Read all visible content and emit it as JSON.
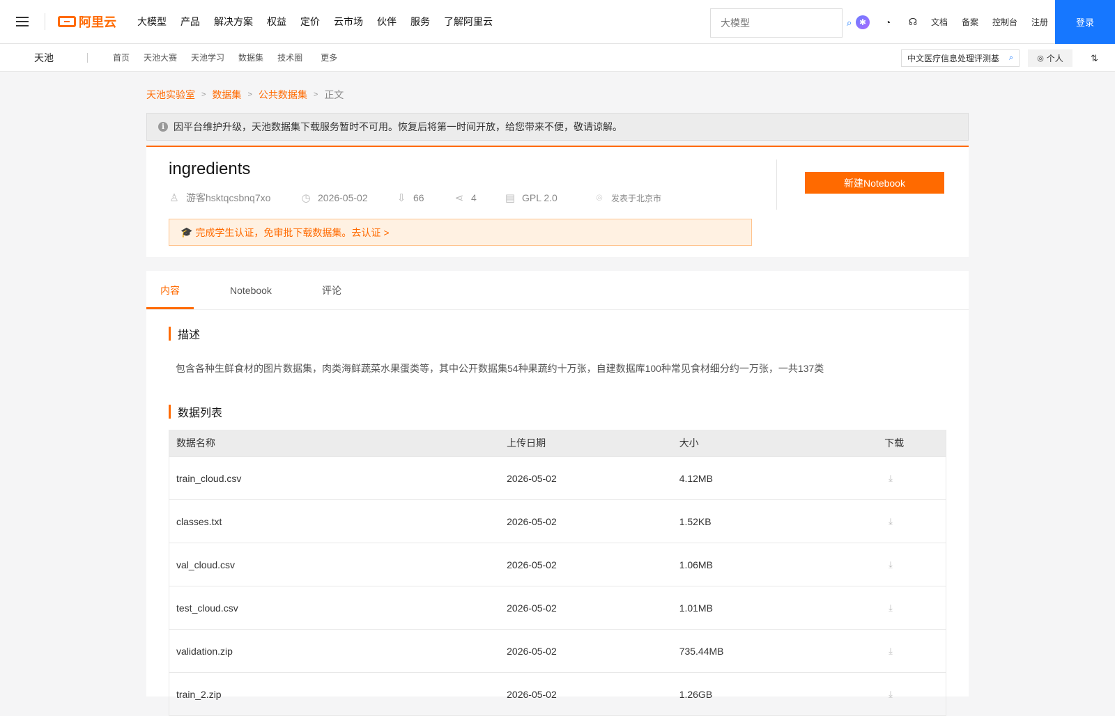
{
  "topnav": {
    "brand": "阿里云",
    "items": [
      "大模型",
      "产品",
      "解决方案",
      "权益",
      "定价",
      "云市场",
      "伙伴",
      "服务",
      "了解阿里云"
    ],
    "search_placeholder": "大模型",
    "links": [
      "文档",
      "备案",
      "控制台",
      "注册"
    ],
    "login": "登录"
  },
  "subnav": {
    "title": "天池",
    "items": [
      "首页",
      "天池大赛",
      "天池学习",
      "数据集",
      "技术圈"
    ],
    "more": "更多",
    "search_value": "中文医疗信息处理评测基",
    "personal": "个人"
  },
  "breadcrumb": [
    "天池实验室",
    "数据集",
    "公共数据集"
  ],
  "breadcrumb_current": "正文",
  "notice": "因平台维护升级，天池数据集下载服务暂时不可用。恢复后将第一时间开放，给您带来不便，敬请谅解。",
  "dataset": {
    "title": "ingredients",
    "author": "游客hsktqcsbnq7xo",
    "date": "2026-05-02",
    "downloads": "66",
    "shares": "4",
    "license": "GPL 2.0",
    "location": "发表于北京市",
    "new_notebook": "新建Notebook",
    "student_notice": "完成学生认证，免审批下载数据集。去认证 >"
  },
  "tabs": [
    "内容",
    "Notebook",
    "评论"
  ],
  "description": {
    "title": "描述",
    "text": "包含各种生鲜食材的图片数据集，肉类海鲜蔬菜水果蛋类等，其中公开数据集54种果蔬约十万张，自建数据库100种常见食材细分约一万张，一共137类"
  },
  "datalist": {
    "title": "数据列表",
    "headers": [
      "数据名称",
      "上传日期",
      "大小",
      "下载"
    ],
    "rows": [
      {
        "name": "train_cloud.csv",
        "date": "2026-05-02",
        "size": "4.12MB"
      },
      {
        "name": "classes.txt",
        "date": "2026-05-02",
        "size": "1.52KB"
      },
      {
        "name": "val_cloud.csv",
        "date": "2026-05-02",
        "size": "1.06MB"
      },
      {
        "name": "test_cloud.csv",
        "date": "2026-05-02",
        "size": "1.01MB"
      },
      {
        "name": "validation.zip",
        "date": "2026-05-02",
        "size": "735.44MB"
      },
      {
        "name": "train_2.zip",
        "date": "2026-05-02",
        "size": "1.26GB"
      }
    ]
  },
  "colors": {
    "accent": "#ff6a00",
    "primary": "#1677ff"
  }
}
